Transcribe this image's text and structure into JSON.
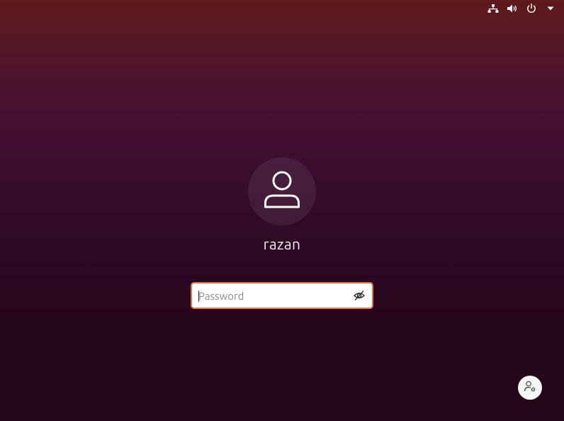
{
  "system_indicators": {
    "network_icon": "network-wired-icon",
    "volume_icon": "volume-icon",
    "power_icon": "power-icon",
    "menu_icon": "caret-down-icon"
  },
  "user": {
    "avatar_icon": "user-icon",
    "name": "razan"
  },
  "login": {
    "password_placeholder": "Password",
    "password_value": "",
    "reveal_icon": "eye-slash-icon"
  },
  "session": {
    "icon": "user-settings-icon"
  },
  "colors": {
    "background_top": "#5e1a1c",
    "background_bottom": "#230619",
    "focus_border": "#e9713d"
  }
}
